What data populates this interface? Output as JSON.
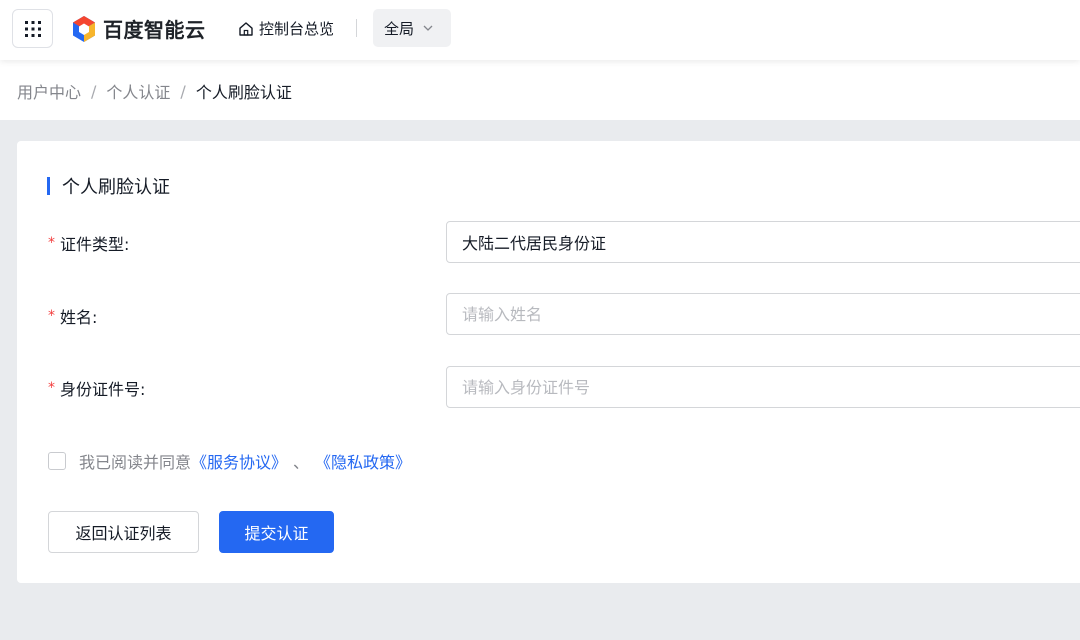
{
  "header": {
    "brand": "百度智能云",
    "console_label": "控制台总览",
    "region_label": "全局"
  },
  "breadcrumb": {
    "items": [
      "用户中心",
      "个人认证",
      "个人刷脸认证"
    ],
    "separator": "/"
  },
  "form": {
    "title": "个人刷脸认证",
    "required_mark": "*",
    "id_type": {
      "label": "证件类型:",
      "value": "大陆二代居民身份证"
    },
    "name": {
      "label": "姓名:",
      "value": "",
      "placeholder": "请输入姓名"
    },
    "id_number": {
      "label": "身份证件号:",
      "value": "",
      "placeholder": "请输入身份证件号"
    },
    "agreement": {
      "text": "我已阅读并同意",
      "service_link": "《服务协议》",
      "separator": "、",
      "privacy_link": "《隐私政策》",
      "checked": false
    },
    "buttons": {
      "back": "返回认证列表",
      "submit": "提交认证"
    }
  },
  "colors": {
    "primary": "#2468f2",
    "required": "#f33e3e",
    "background": "#e9ebee"
  },
  "icons": [
    "grid-icon",
    "logo-icon",
    "home-icon",
    "chevron-down-icon"
  ]
}
